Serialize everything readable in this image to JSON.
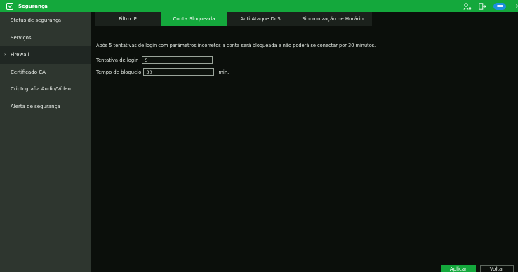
{
  "window": {
    "title": "Segurança"
  },
  "sidebar": {
    "items": [
      {
        "label": "Status de segurança",
        "arrow": ""
      },
      {
        "label": "Serviços",
        "arrow": ""
      },
      {
        "label": "Firewall",
        "arrow": "›"
      },
      {
        "label": "Certificado CA",
        "arrow": ""
      },
      {
        "label": "Criptografia Áudio/Vídeo",
        "arrow": ""
      },
      {
        "label": "Alerta de segurança",
        "arrow": ""
      }
    ],
    "active_index": 2
  },
  "tabs": [
    {
      "label": "Filtro IP"
    },
    {
      "label": "Conta Bloqueada"
    },
    {
      "label": "Anti Ataque DoS"
    },
    {
      "label": "Sincronização de Horário"
    }
  ],
  "active_tab": 1,
  "main": {
    "notice": "Após 5 tentativas de login com parâmetros incorretos a conta será bloqueada e não poderá se conectar por 30 minutos.",
    "login_attempts": {
      "label": "Tentativa de login",
      "value": "5"
    },
    "lock_time": {
      "label": "Tempo de bloqueio",
      "value": "30",
      "unit": "min."
    }
  },
  "buttons": {
    "apply": "Aplicar",
    "back": "Voltar"
  },
  "icons": [
    "shield-icon",
    "user-icon",
    "exit-icon",
    "cloud-icon",
    "close-icon"
  ],
  "colors": {
    "accent": "#14a83c",
    "sidebar": "#2e362f",
    "background": "#0b0f0b"
  }
}
